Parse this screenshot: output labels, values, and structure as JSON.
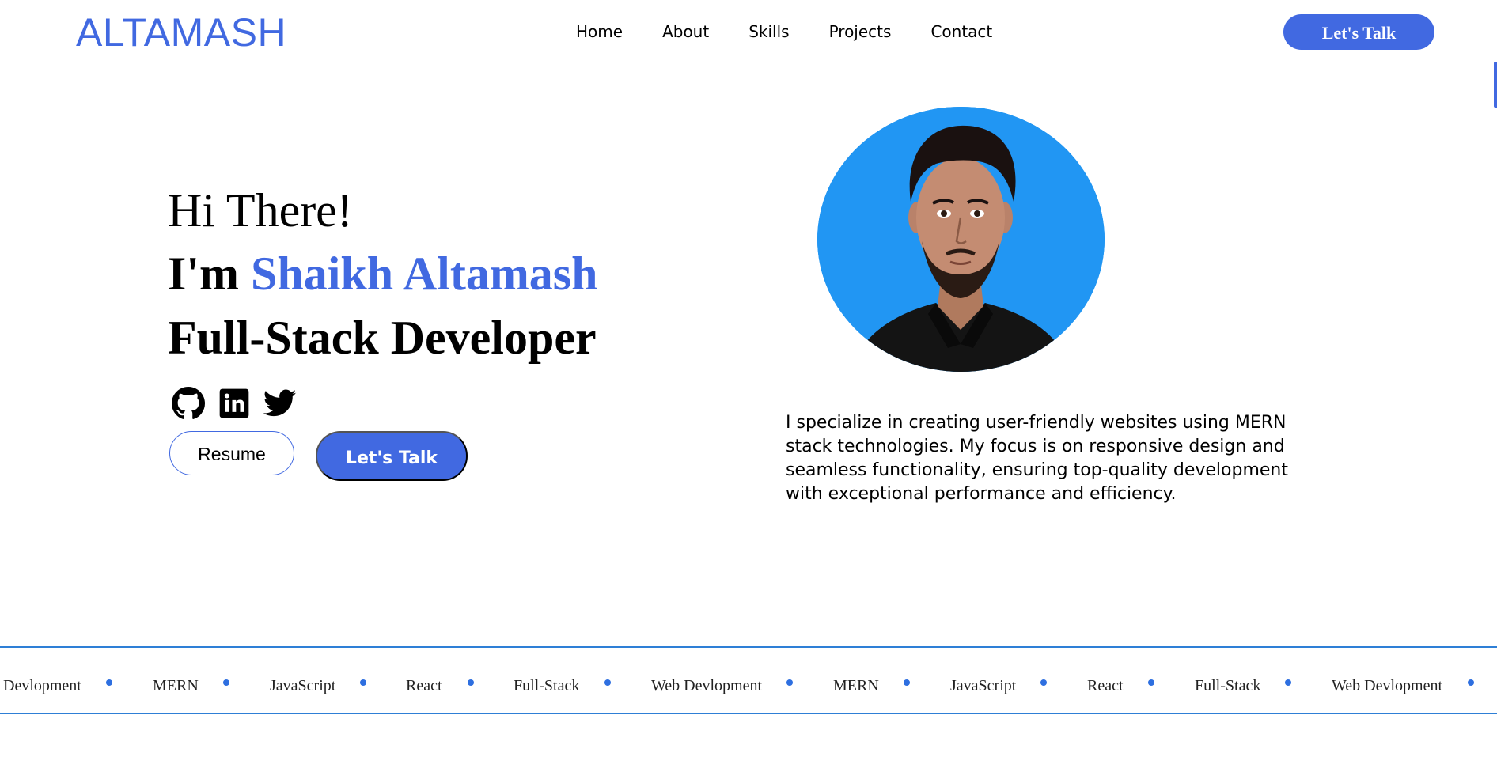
{
  "nav": {
    "brand": "ALTAMASH",
    "links": [
      "Home",
      "About",
      "Skills",
      "Projects",
      "Contact"
    ],
    "cta_label": "Let's Talk"
  },
  "hero": {
    "greeting": "Hi There!",
    "intro_prefix": "I'm ",
    "name": "Shaikh Altamash",
    "role": "Full-Stack Developer",
    "socials": [
      "github-icon",
      "linkedin-icon",
      "twitter-icon"
    ],
    "resume_label": "Resume",
    "talk_label": "Let's Talk",
    "bio": "I specialize in creating user-friendly websites using MERN stack technologies. My focus is on responsive design and seamless functionality, ensuring top-quality development with exceptional performance and efficiency."
  },
  "marquee": {
    "items": [
      "Devlopment",
      "MERN",
      "JavaScript",
      "React",
      "Full-Stack",
      "Web Devlopment",
      "MERN",
      "JavaScript",
      "React",
      "Full-Stack",
      "Web Devlopment"
    ]
  },
  "colors": {
    "accent": "#4169e1",
    "avatar_bg": "#2196f3",
    "marquee_line": "#2e7fd6"
  }
}
